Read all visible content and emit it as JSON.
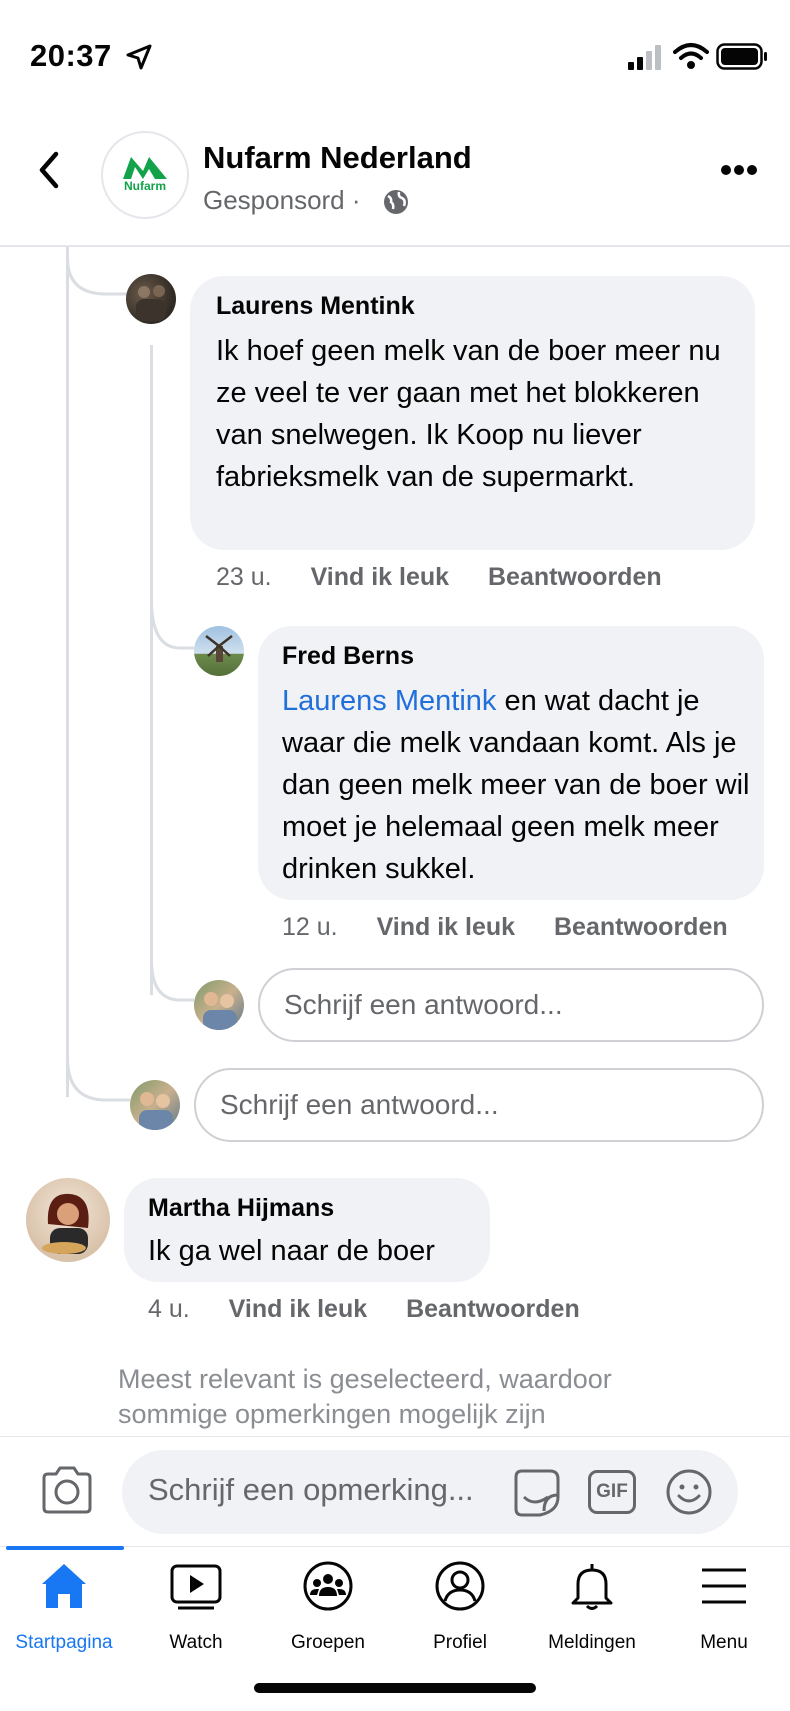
{
  "status_bar": {
    "time": "20:37"
  },
  "header": {
    "page_name": "Nufarm Nederland",
    "sponsored": "Gesponsord ·",
    "logo_text": "Nufarm"
  },
  "comments": [
    {
      "name": "Laurens Mentink",
      "text": "Ik hoef geen melk van de boer meer nu ze veel te ver gaan met het blokkeren van snelwegen. Ik Koop nu liever fabrieksmelk van de supermarkt.",
      "time": "23 u.",
      "like": "Vind ik leuk",
      "reply": "Beantwoorden"
    },
    {
      "name": "Fred Berns",
      "mention": "Laurens Mentink",
      "text": " en wat dacht je waar die melk vandaan komt. Als je dan geen melk meer van de boer wil moet je helemaal geen melk meer drinken sukkel.",
      "time": "12 u.",
      "like": "Vind ik leuk",
      "reply": "Beantwoorden"
    },
    {
      "name": "Martha Hijmans",
      "text": "Ik ga wel naar de boer",
      "time": "4 u.",
      "like": "Vind ik leuk",
      "reply": "Beantwoorden"
    }
  ],
  "reply_placeholder": "Schrijf een antwoord...",
  "notice": "Meest relevant is geselecteerd, waardoor sommige opmerkingen mogelijk zijn",
  "composer": {
    "placeholder": "Schrijf een opmerking...",
    "gif": "GIF"
  },
  "tabs": [
    {
      "label": "Startpagina",
      "icon": "home-icon",
      "active": true
    },
    {
      "label": "Watch",
      "icon": "watch-icon"
    },
    {
      "label": "Groepen",
      "icon": "groups-icon"
    },
    {
      "label": "Profiel",
      "icon": "profile-icon"
    },
    {
      "label": "Meldingen",
      "icon": "bell-icon"
    },
    {
      "label": "Menu",
      "icon": "menu-icon"
    }
  ],
  "colors": {
    "accent": "#1877f2",
    "bubble": "#f0f2f5",
    "mention": "#216fdb",
    "brand_green": "#12a34a"
  }
}
